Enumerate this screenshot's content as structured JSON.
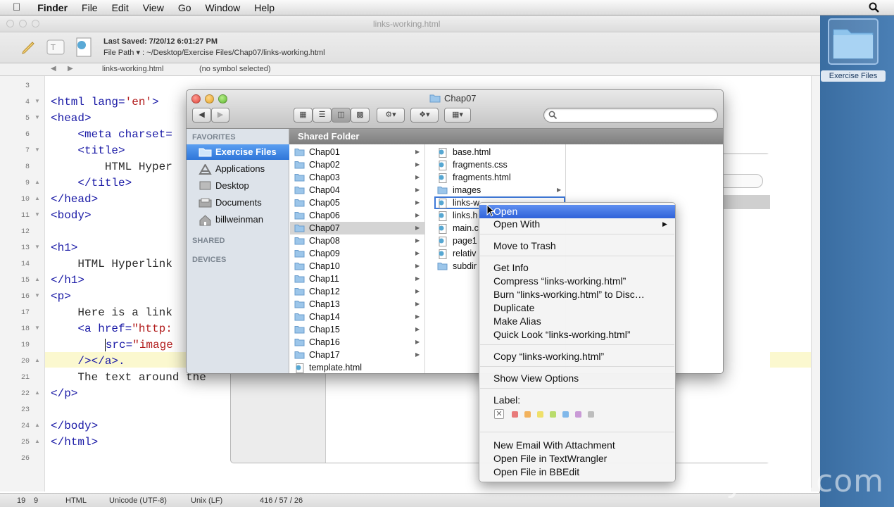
{
  "menubar": {
    "app_name": "Finder",
    "items": [
      "File",
      "Edit",
      "View",
      "Go",
      "Window",
      "Help"
    ]
  },
  "desktop": {
    "folder_label": "Exercise Files"
  },
  "editor": {
    "window_title": "links-working.html",
    "last_saved": "Last Saved: 7/20/12 6:01:27 PM",
    "file_path": "File Path ▾ : ~/Desktop/Exercise Files/Chap07/links-working.html",
    "nav_file": "links-working.html",
    "nav_symbol": "(no symbol selected)",
    "line_numbers": [
      "3",
      "4",
      "5",
      "6",
      "7",
      "8",
      "9",
      "10",
      "11",
      "12",
      "13",
      "14",
      "15",
      "16",
      "17",
      "18",
      "19",
      "20",
      "21",
      "22",
      "23",
      "24",
      "25",
      "26"
    ],
    "code": {
      "l4a": "<html lang=",
      "l4b": "'en'",
      "l4c": ">",
      "l5": "<head>",
      "l6": "    <meta charset=",
      "l7": "    <title>",
      "l8": "        HTML Hyper",
      "l9": "    </title>",
      "l10": "</head>",
      "l11": "<body>",
      "l13": "<h1>",
      "l14": "    HTML Hyperlink",
      "l15": "</h1>",
      "l16": "<p>",
      "l17": "    Here is a link",
      "l18a": "    <a href=",
      "l18b": "\"http:",
      "l19a": "        ",
      "l19b": "src=",
      "l19c": "\"image",
      "l20": "    /></a>.",
      "l21": "    The text around the",
      "l22": "</p>",
      "l24": "</body>",
      "l25": "</html>"
    },
    "status": {
      "line": "19",
      "col": "9",
      "language": "HTML",
      "encoding": "Unicode (UTF-8)",
      "line_endings": "Unix (LF)",
      "counts": "416 / 57 / 26"
    }
  },
  "finder": {
    "title": "Chap07",
    "sidebar": {
      "favorites_header": "FAVORITES",
      "items": [
        "Exercise Files",
        "Applications",
        "Desktop",
        "Documents",
        "billweinman"
      ],
      "shared_header": "SHARED",
      "devices_header": "DEVICES"
    },
    "path_header": "Shared Folder",
    "column1": [
      "Chap01",
      "Chap02",
      "Chap03",
      "Chap04",
      "Chap05",
      "Chap06",
      "Chap07",
      "Chap08",
      "Chap09",
      "Chap10",
      "Chap11",
      "Chap12",
      "Chap13",
      "Chap14",
      "Chap15",
      "Chap16",
      "Chap17",
      "template.html"
    ],
    "column2": [
      "base.html",
      "fragments.css",
      "fragments.html",
      "images",
      "links-w",
      "links.h",
      "main.c",
      "page1",
      "relativ",
      "subdir"
    ]
  },
  "context_menu": {
    "open": "Open",
    "open_with": "Open With",
    "move_to_trash": "Move to Trash",
    "get_info": "Get Info",
    "compress": "Compress “links-working.html”",
    "burn": "Burn “links-working.html” to Disc…",
    "duplicate": "Duplicate",
    "make_alias": "Make Alias",
    "quick_look": "Quick Look “links-working.html”",
    "copy": "Copy “links-working.html”",
    "show_view_options": "Show View Options",
    "label_heading": "Label:",
    "label_colors": [
      "#e87a7a",
      "#f2b25d",
      "#efe06a",
      "#b9dc6c",
      "#80b8ea",
      "#c99ad6",
      "#bdbdbd"
    ],
    "new_email": "New Email With Attachment",
    "open_textwrangler": "Open File in TextWrangler",
    "open_bbedit": "Open File in BBEdit"
  },
  "watermark": "lynda.com"
}
